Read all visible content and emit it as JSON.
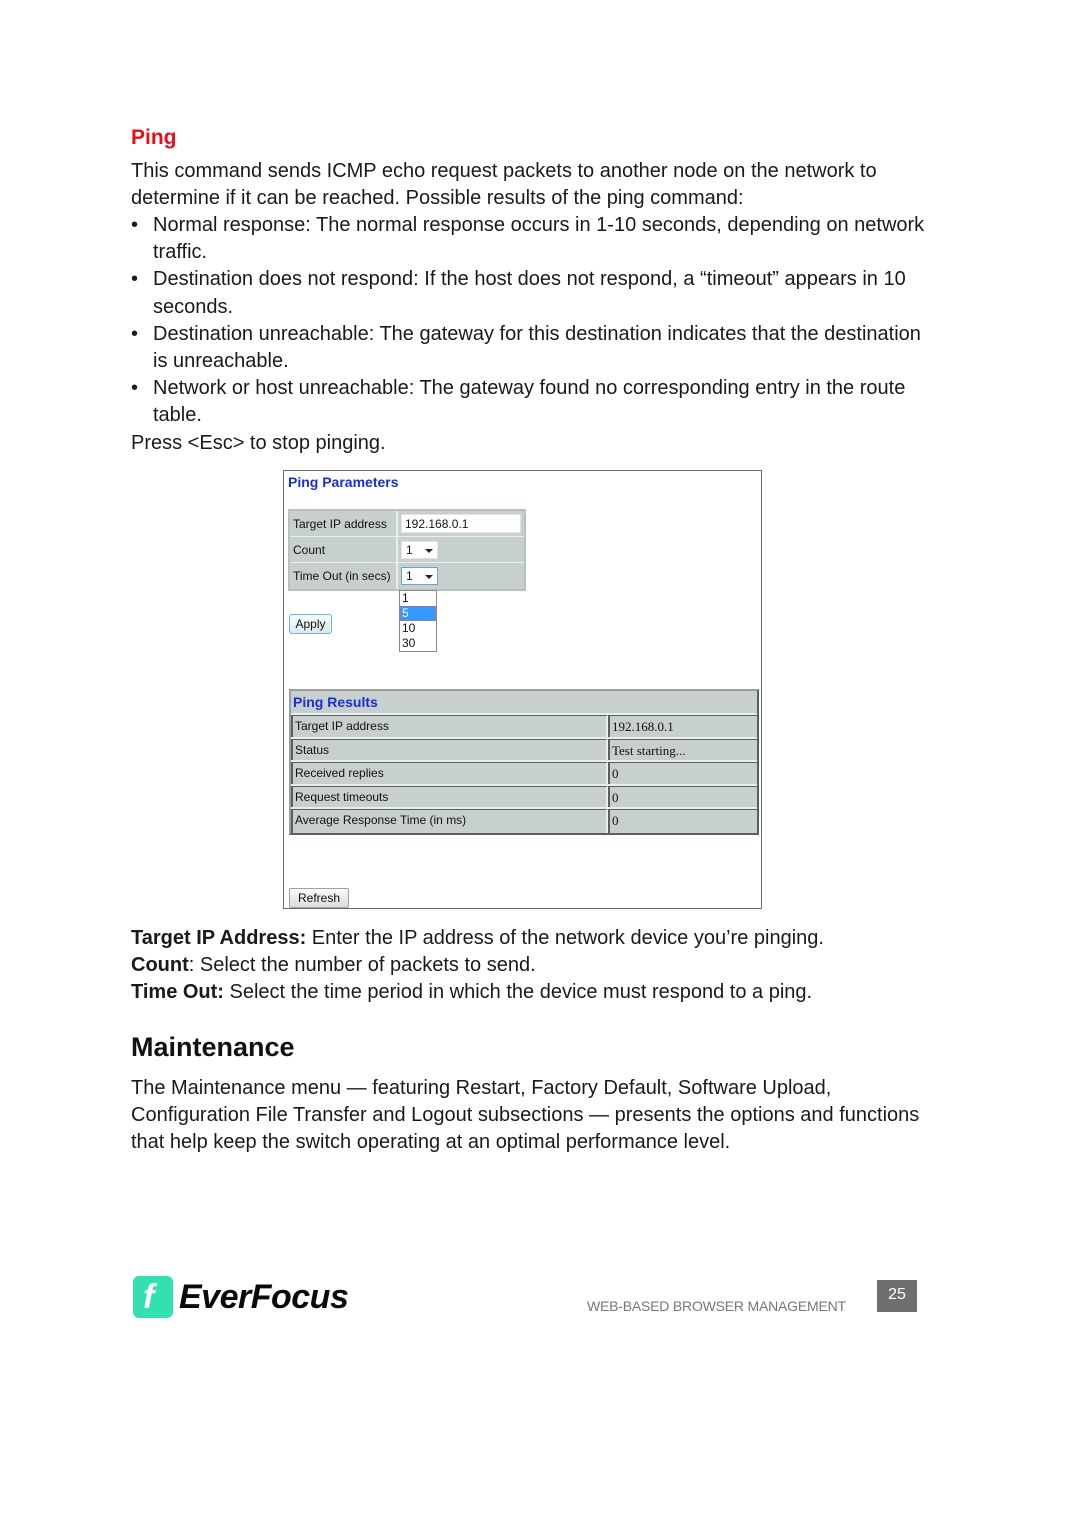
{
  "ping_section": {
    "title": "Ping",
    "intro": "This command sends ICMP echo request packets to another node on the network to determine if it can be reached. Possible results of the ping command:",
    "bullets": [
      "Normal response: The normal response occurs in 1-10 seconds, depending on network traffic.",
      "Destination does not respond: If the host does not respond, a “timeout” appears in 10 seconds.",
      "Destination unreachable: The gateway for this destination indicates that the destination is unreachable.",
      "Network or host unreachable: The gateway found no corresponding entry in the route table."
    ],
    "bullet_char": "•",
    "press_note": "Press <Esc> to stop pinging."
  },
  "screenshot": {
    "params_title": "Ping Parameters",
    "params": {
      "target_ip_label": "Target IP address",
      "target_ip_value": "192.168.0.1",
      "count_label": "Count",
      "count_value": "1",
      "timeout_label": "Time Out (in secs)",
      "timeout_value": "1"
    },
    "timeout_options": [
      "1",
      "5",
      "10",
      "30"
    ],
    "timeout_highlighted": "5",
    "apply_label": "Apply",
    "results_title": "Ping Results",
    "results": [
      {
        "label": "Target IP address",
        "value": "192.168.0.1"
      },
      {
        "label": "Status",
        "value": "Test starting..."
      },
      {
        "label": "Received replies",
        "value": "0"
      },
      {
        "label": "Request timeouts",
        "value": "0"
      },
      {
        "label": "Average Response Time (in ms)",
        "value": "0"
      }
    ],
    "refresh_label": "Refresh"
  },
  "definitions": [
    {
      "term": "Target IP Address:",
      "text": " Enter the IP address of the network device you’re pinging."
    },
    {
      "term": "Count",
      "text": ": Select the number of packets to send."
    },
    {
      "term": "Time Out:",
      "text": " Select the time period in which the device must respond to a ping."
    }
  ],
  "maintenance": {
    "heading": "Maintenance",
    "text": "The Maintenance menu — featuring Restart, Factory Default, Software Upload, Configuration File Transfer and Logout subsections — presents the options and functions that help keep the switch operating at an optimal performance level."
  },
  "footer": {
    "brand": "EverFocus",
    "logo_glyph": "f",
    "section_name": "WEB-BASED BROWSER MANAGEMENT",
    "page_number": "25",
    "brand_color": "#33e0b0"
  },
  "colors": {
    "section_title": "#e3101b",
    "ui_heading": "#1a2fd0"
  }
}
